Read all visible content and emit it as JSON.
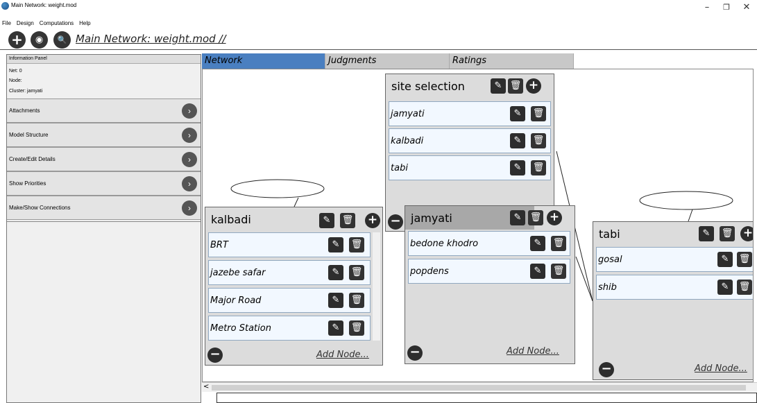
{
  "window": {
    "title": "Main Network: weight.mod",
    "minimize": "–",
    "restore": "❐",
    "close": "✕"
  },
  "menu": [
    "File",
    "Design",
    "Computations",
    "Help"
  ],
  "toolbar": {
    "add_icon": "+",
    "view_icon": "◉",
    "zoom_icon": "🔍",
    "network_title": "Main Network: weight.mod //"
  },
  "info_panel": {
    "header": "Information Panel",
    "net": "Net: 0",
    "node": "Node:",
    "cluster": "Cluster: jamyati",
    "sections": [
      "Attachments",
      "Model Structure",
      "Create/Edit Details",
      "Show Priorities",
      "Make/Show Connections"
    ]
  },
  "tabs": [
    "Network",
    "Judgments",
    "Ratings"
  ],
  "clusters": {
    "site_selection": {
      "name": "site selection",
      "nodes": [
        "jamyati",
        "kalbadi",
        "tabi"
      ]
    },
    "kalbadi": {
      "name": "kalbadi",
      "nodes": [
        "BRT",
        "jazebe safar",
        "Major Road",
        "Metro Station"
      ],
      "add_node": "Add Node..."
    },
    "jamyati": {
      "name": "jamyati",
      "nodes": [
        "bedone khodro",
        "popdens"
      ],
      "add_node": "Add Node..."
    },
    "tabi": {
      "name": "tabi",
      "nodes": [
        "gosal",
        "shib"
      ],
      "add_node": "Add Node..."
    }
  },
  "colors": {
    "active_tab": "#4a7fc0",
    "node_bg": "#f2f8ff",
    "cluster_bg": "#dcdcdc"
  },
  "scroll": {
    "left_arrow": "<"
  }
}
